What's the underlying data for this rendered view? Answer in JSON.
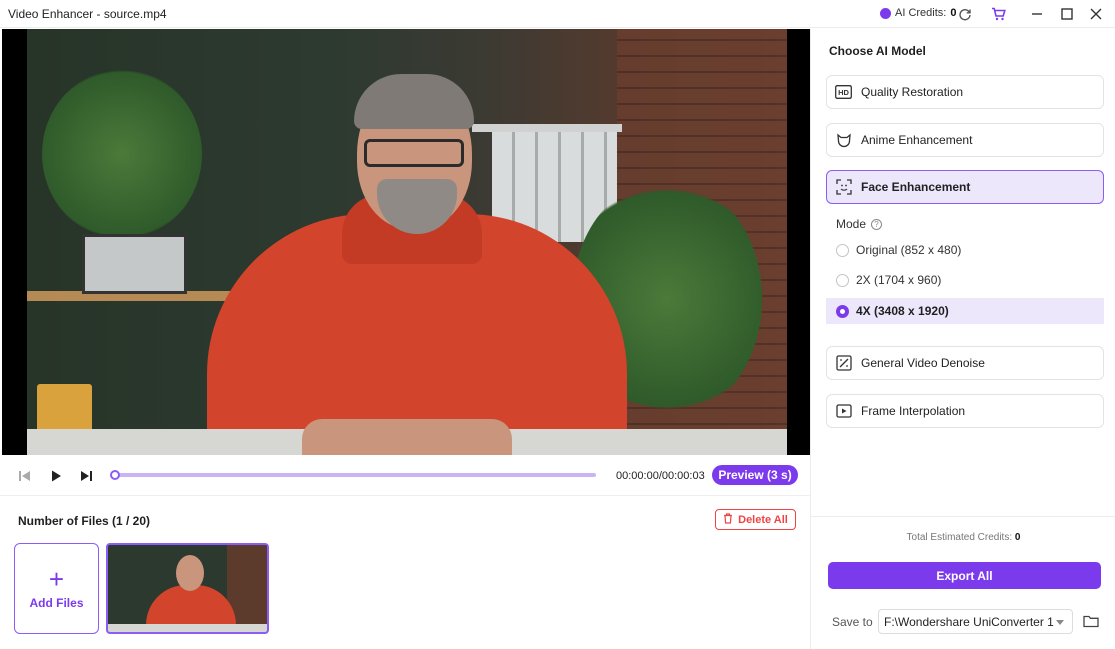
{
  "window": {
    "title": "Video Enhancer - source.mp4"
  },
  "titlebar": {
    "credits_label": "AI Credits:",
    "credits_value": "0",
    "icons": [
      "coin-icon",
      "refresh-icon",
      "cart-icon",
      "minimize-icon",
      "maximize-icon",
      "close-icon"
    ]
  },
  "player": {
    "time": "00:00:00/00:00:03",
    "preview_label": "Preview (3 s)",
    "progress_fraction": 0.0
  },
  "files": {
    "count_label": "Number of Files (1 / 20)",
    "delete_all_label": "Delete All",
    "add_files_label": "Add Files"
  },
  "panel": {
    "title": "Choose AI Model",
    "models": [
      {
        "label": "Quality Restoration",
        "icon": "hd-icon"
      },
      {
        "label": "Anime Enhancement",
        "icon": "anime-icon"
      },
      {
        "label": "Face Enhancement",
        "icon": "face-scan-icon"
      },
      {
        "label": "General Video Denoise",
        "icon": "denoise-icon"
      },
      {
        "label": "Frame Interpolation",
        "icon": "frame-icon"
      }
    ],
    "selected_model": "Face Enhancement",
    "mode_label": "Mode",
    "mode_options": [
      "Original (852 x 480)",
      "2X (1704 x 960)",
      "4X (3408 x 1920)"
    ],
    "selected_mode": "4X (3408 x 1920)",
    "estimated_label": "Total Estimated Credits:",
    "estimated_value": "0",
    "export_label": "Export All",
    "save_to_label": "Save to",
    "save_path": "F:\\Wondershare UniConverter 1"
  },
  "colors": {
    "accent": "#7c3aed",
    "accent_light": "#ede7fb",
    "danger": "#ef4444"
  }
}
